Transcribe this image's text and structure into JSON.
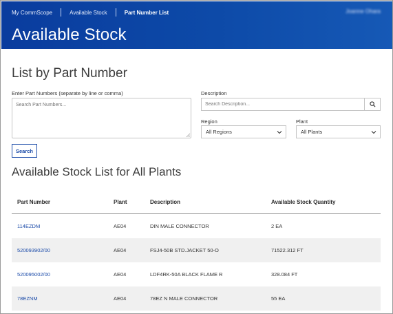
{
  "nav": {
    "items": [
      {
        "label": "My CommScope"
      },
      {
        "label": "Available Stock"
      },
      {
        "label": "Part Number List"
      }
    ],
    "user_name": "Joanne Ohara"
  },
  "page": {
    "title": "Available Stock",
    "section_heading": "List by Part Number"
  },
  "form": {
    "part_numbers_label": "Enter Part Numbers (separate by line or comma)",
    "part_numbers_placeholder": "Search Part Numbers...",
    "description_label": "Description",
    "description_placeholder": "Search Description...",
    "region_label": "Region",
    "region_value": "All Regions",
    "plant_label": "Plant",
    "plant_value": "All Plants",
    "search_button": "Search"
  },
  "list": {
    "heading": "Available Stock List for All Plants",
    "columns": [
      "Part Number",
      "Plant",
      "Description",
      "Available Stock Quantity"
    ],
    "rows": [
      {
        "part_number": "114EZDM",
        "plant": "AE04",
        "description": "DIN MALE CONNECTOR",
        "quantity": "2 EA"
      },
      {
        "part_number": "520093902/00",
        "plant": "AE04",
        "description": "FSJ4-50B STD.JACKET 50-O",
        "quantity": "71522.312 FT"
      },
      {
        "part_number": "520095002/00",
        "plant": "AE04",
        "description": "LDF4RK-50A BLACK FLAME R",
        "quantity": "328.084 FT"
      },
      {
        "part_number": "78EZNM",
        "plant": "AE04",
        "description": "78EZ N MALE CONNECTOR",
        "quantity": "55 EA"
      }
    ]
  },
  "colors": {
    "header_blue": "#0d4aa8",
    "link_blue": "#1a4aa8",
    "row_shade": "#f0f0f0"
  }
}
